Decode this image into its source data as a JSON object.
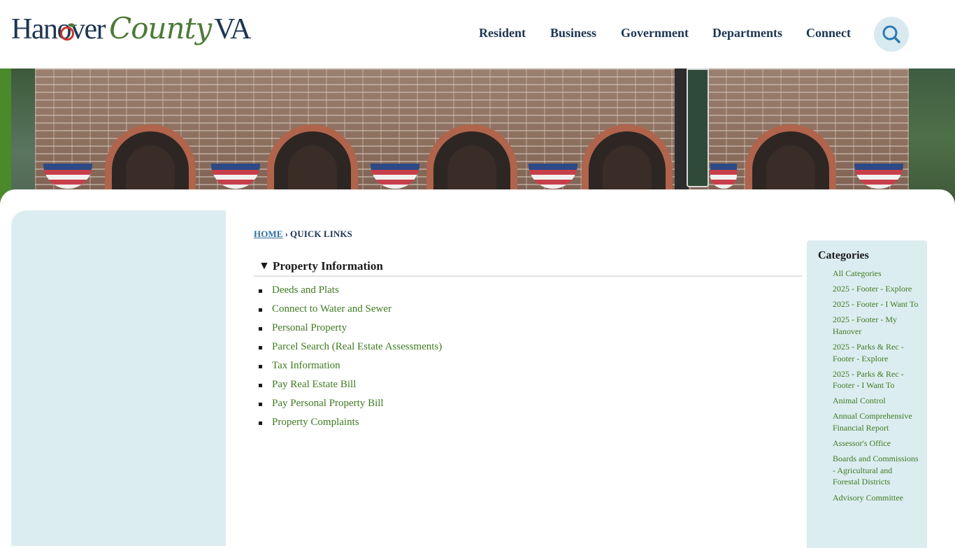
{
  "logo": {
    "word1": "Hanover",
    "word2": "County",
    "word3": "VA"
  },
  "nav": {
    "items": [
      "Resident",
      "Business",
      "Government",
      "Departments",
      "Connect"
    ],
    "search_icon": "search-icon"
  },
  "breadcrumb": {
    "home": "HOME",
    "separator": "›",
    "current": "QUICK LINKS"
  },
  "section": {
    "toggle_icon": "▼",
    "title": "Property Information",
    "links": [
      "Deeds and Plats",
      "Connect to Water and Sewer",
      "Personal Property",
      "Parcel Search (Real Estate Assessments)",
      "Tax Information",
      "Pay Real Estate Bill",
      "Pay Personal Property Bill",
      "Property Complaints"
    ]
  },
  "categories": {
    "title": "Categories",
    "items": [
      "All Categories",
      "2025 - Footer - Explore",
      "2025 - Footer - I Want To",
      "2025 - Footer - My Hanover",
      "2025 - Parks & Rec - Footer - Explore",
      "2025 - Parks & Rec - Footer - I Want To",
      "Animal Control",
      "Annual Comprehensive Financial Report",
      "Assessor's Office",
      "Boards and Commissions - Agricultural and Forestal Districts",
      "Advisory Committee"
    ]
  },
  "colors": {
    "navy": "#1e3553",
    "green_link": "#3e7a1f",
    "panel_blue": "#dcedf1",
    "accent_green": "#4a8a2a"
  }
}
